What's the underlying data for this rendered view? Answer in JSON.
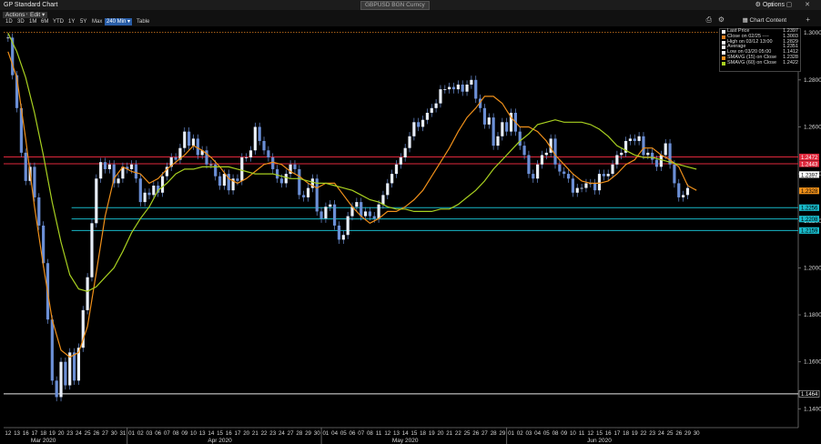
{
  "window": {
    "title": "GP Standard Chart",
    "ticker": "GBPUSD BGN Curncy",
    "options_label": "Options",
    "chart_content_label": "Chart Content",
    "controls": "▭ ▢ ✕"
  },
  "toolbar": {
    "menus": [
      "Actions ▾",
      "Edit ▾"
    ],
    "ranges": [
      "1D",
      "3D",
      "1M",
      "6M",
      "YTD",
      "1Y",
      "5Y",
      "Max",
      "240 Min ▾",
      "Table"
    ],
    "active_range": "240 Min ▾"
  },
  "colors": {
    "price": "#6b8fd6",
    "sma15": "#f0901a",
    "sma60": "#a8d020",
    "resistance": "#e0283c",
    "support": "#18b8c8",
    "low_line": "#e8e8e8",
    "high_dotted": "#e08020"
  },
  "legend": [
    {
      "label": "Last Price",
      "value": "1.2397",
      "color": "#ffffff"
    },
    {
      "label": "Close on 02/25 ----",
      "value": "1.3003",
      "color": "#e08020"
    },
    {
      "label": "High on 03/12 13:00",
      "value": "1.2829",
      "color": "#ffffff"
    },
    {
      "label": "Average",
      "value": "1.2351",
      "color": "#ffffff"
    },
    {
      "label": "Low on 03/20 05:00",
      "value": "1.1412",
      "color": "#ffffff"
    },
    {
      "label": "SMAVG (15)  on Close",
      "value": "1.2328",
      "color": "#f0901a"
    },
    {
      "label": "SMAVG (60)  on Close",
      "value": "1.2422",
      "color": "#a8d020"
    }
  ],
  "chart_data": {
    "type": "line",
    "title": "",
    "xlabel": "",
    "ylabel": "",
    "ylim": [
      1.132,
      1.302
    ],
    "y_ticks": [
      "1.3000",
      "1.2800",
      "1.2600",
      "1.2400",
      "1.2200",
      "1.2000",
      "1.1800",
      "1.1600",
      "1.1400"
    ],
    "x_days": [
      "12",
      "13",
      "16",
      "17",
      "18",
      "19",
      "20",
      "23",
      "24",
      "25",
      "26",
      "27",
      "30",
      "31",
      "01",
      "02",
      "03",
      "06",
      "07",
      "08",
      "09",
      "10",
      "13",
      "14",
      "15",
      "16",
      "17",
      "20",
      "21",
      "22",
      "23",
      "24",
      "27",
      "28",
      "29",
      "30",
      "01",
      "04",
      "05",
      "06",
      "07",
      "08",
      "11",
      "12",
      "13",
      "14",
      "15",
      "18",
      "19",
      "20",
      "21",
      "22",
      "25",
      "26",
      "27",
      "28",
      "29",
      "01",
      "02",
      "03",
      "04",
      "05",
      "08",
      "09",
      "10",
      "11",
      "12",
      "15",
      "16",
      "17",
      "18",
      "19",
      "22",
      "23",
      "24",
      "25",
      "26",
      "29",
      "30"
    ],
    "x_months": [
      {
        "label": "Mar 2020",
        "day_index": 4
      },
      {
        "label": "Apr 2020",
        "day_index": 24
      },
      {
        "label": "May 2020",
        "day_index": 45
      },
      {
        "label": "Jun 2020",
        "day_index": 67
      }
    ],
    "month_separators": [
      14,
      36,
      57
    ],
    "series": [
      {
        "name": "Last Price",
        "day_index": [
          0,
          0.5,
          1,
          1.5,
          2,
          2.5,
          3,
          3.5,
          4,
          4.5,
          5,
          5.5,
          6,
          6.5,
          7,
          7.5,
          8,
          8.5,
          9,
          9.5,
          10,
          10.5,
          11,
          11.5,
          12,
          12.5,
          13,
          13.5,
          14,
          14.5,
          15,
          15.5,
          16,
          16.5,
          17,
          17.5,
          18,
          18.5,
          19,
          19.5,
          20,
          20.5,
          21,
          21.5,
          22,
          22.5,
          23,
          23.5,
          24,
          24.5,
          25,
          25.5,
          26,
          26.5,
          27,
          27.5,
          28,
          28.5,
          29,
          29.5,
          30,
          30.5,
          31,
          31.5,
          32,
          32.5,
          33,
          33.5,
          34,
          34.5,
          35,
          35.5,
          36,
          36.5,
          37,
          37.5,
          38,
          38.5,
          39,
          39.5,
          40,
          40.5,
          41,
          41.5,
          42,
          42.5,
          43,
          43.5,
          44,
          44.5,
          45,
          45.5,
          46,
          46.5,
          47,
          47.5,
          48,
          48.5,
          49,
          49.5,
          50,
          50.5,
          51,
          51.5,
          52,
          52.5,
          53,
          53.5,
          54,
          54.5,
          55,
          55.5,
          56,
          56.5,
          57,
          57.5,
          58,
          58.5,
          59,
          59.5,
          60,
          60.5,
          61,
          61.5,
          62,
          62.5,
          63,
          63.5,
          64,
          64.5,
          65,
          65.5,
          66,
          66.5,
          67,
          67.5,
          68,
          68.5,
          69,
          69.5,
          70,
          70.5,
          71,
          71.5,
          72,
          72.5,
          73,
          73.5,
          74,
          74.5,
          75,
          75.5,
          76,
          76.5,
          77,
          77.5,
          78
        ],
        "values": [
          1.298,
          1.282,
          1.268,
          1.249,
          1.237,
          1.243,
          1.23,
          1.218,
          1.202,
          1.178,
          1.152,
          1.145,
          1.16,
          1.15,
          1.164,
          1.152,
          1.166,
          1.182,
          1.196,
          1.219,
          1.238,
          1.245,
          1.242,
          1.244,
          1.236,
          1.238,
          1.243,
          1.242,
          1.244,
          1.238,
          1.228,
          1.232,
          1.231,
          1.235,
          1.232,
          1.239,
          1.243,
          1.247,
          1.246,
          1.251,
          1.258,
          1.252,
          1.255,
          1.248,
          1.25,
          1.244,
          1.244,
          1.239,
          1.235,
          1.24,
          1.233,
          1.238,
          1.237,
          1.247,
          1.247,
          1.25,
          1.26,
          1.254,
          1.25,
          1.247,
          1.242,
          1.238,
          1.236,
          1.24,
          1.244,
          1.242,
          1.231,
          1.23,
          1.234,
          1.238,
          1.224,
          1.221,
          1.226,
          1.227,
          1.218,
          1.212,
          1.214,
          1.222,
          1.226,
          1.228,
          1.222,
          1.224,
          1.222,
          1.221,
          1.227,
          1.231,
          1.236,
          1.24,
          1.244,
          1.247,
          1.251,
          1.256,
          1.262,
          1.26,
          1.263,
          1.266,
          1.268,
          1.27,
          1.276,
          1.276,
          1.277,
          1.276,
          1.278,
          1.275,
          1.278,
          1.28,
          1.272,
          1.268,
          1.261,
          1.264,
          1.252,
          1.256,
          1.262,
          1.258,
          1.266,
          1.258,
          1.252,
          1.248,
          1.24,
          1.238,
          1.244,
          1.248,
          1.249,
          1.255,
          1.244,
          1.241,
          1.24,
          1.238,
          1.232,
          1.234,
          1.234,
          1.236,
          1.236,
          1.233,
          1.24,
          1.239,
          1.24,
          1.244,
          1.248,
          1.249,
          1.254,
          1.255,
          1.254,
          1.256,
          1.248,
          1.249,
          1.246,
          1.243,
          1.248,
          1.253,
          1.244,
          1.236,
          1.23,
          1.231,
          1.234
        ]
      },
      {
        "name": "SMAVG (15)  on Close",
        "day_index": [
          0,
          1,
          2,
          3,
          4,
          5,
          6,
          7,
          8,
          9,
          10,
          11,
          12,
          13,
          14,
          15,
          16,
          17,
          18,
          19,
          20,
          21,
          22,
          23,
          24,
          25,
          26,
          27,
          28,
          29,
          30,
          31,
          32,
          33,
          34,
          35,
          36,
          37,
          38,
          39,
          40,
          41,
          42,
          43,
          44,
          45,
          46,
          47,
          48,
          49,
          50,
          51,
          52,
          53,
          54,
          55,
          56,
          57,
          58,
          59,
          60,
          61,
          62,
          63,
          64,
          65,
          66,
          67,
          68,
          69,
          70,
          71,
          72,
          73,
          74,
          75,
          76,
          77,
          78
        ],
        "values": [
          1.292,
          1.281,
          1.255,
          1.226,
          1.201,
          1.178,
          1.165,
          1.162,
          1.164,
          1.175,
          1.198,
          1.222,
          1.238,
          1.243,
          1.241,
          1.24,
          1.236,
          1.238,
          1.242,
          1.245,
          1.248,
          1.252,
          1.25,
          1.247,
          1.243,
          1.238,
          1.236,
          1.238,
          1.241,
          1.244,
          1.245,
          1.244,
          1.241,
          1.239,
          1.236,
          1.234,
          1.236,
          1.236,
          1.231,
          1.226,
          1.222,
          1.219,
          1.221,
          1.224,
          1.224,
          1.226,
          1.229,
          1.233,
          1.239,
          1.245,
          1.251,
          1.258,
          1.264,
          1.268,
          1.273,
          1.273,
          1.27,
          1.264,
          1.26,
          1.26,
          1.258,
          1.254,
          1.248,
          1.244,
          1.24,
          1.237,
          1.236,
          1.236,
          1.237,
          1.24,
          1.244,
          1.246,
          1.251,
          1.251,
          1.248,
          1.246,
          1.243,
          1.235,
          1.233
        ]
      },
      {
        "name": "SMAVG (60)  on Close",
        "day_index": [
          0,
          1,
          2,
          3,
          4,
          5,
          6,
          7,
          8,
          9,
          10,
          11,
          12,
          13,
          14,
          15,
          16,
          17,
          18,
          19,
          20,
          21,
          22,
          23,
          24,
          25,
          26,
          27,
          28,
          29,
          30,
          31,
          32,
          33,
          34,
          35,
          36,
          37,
          38,
          39,
          40,
          41,
          42,
          43,
          44,
          45,
          46,
          47,
          48,
          49,
          50,
          51,
          52,
          53,
          54,
          55,
          56,
          57,
          58,
          59,
          60,
          61,
          62,
          63,
          64,
          65,
          66,
          67,
          68,
          69,
          70,
          71,
          72,
          73,
          74,
          75,
          76,
          77,
          78
        ],
        "values": [
          1.3,
          1.292,
          1.281,
          1.266,
          1.248,
          1.228,
          1.211,
          1.197,
          1.191,
          1.19,
          1.192,
          1.196,
          1.2,
          1.207,
          1.215,
          1.221,
          1.226,
          1.233,
          1.236,
          1.24,
          1.242,
          1.242,
          1.243,
          1.243,
          1.243,
          1.243,
          1.242,
          1.241,
          1.24,
          1.24,
          1.24,
          1.239,
          1.238,
          1.238,
          1.237,
          1.236,
          1.236,
          1.235,
          1.234,
          1.233,
          1.231,
          1.229,
          1.228,
          1.226,
          1.225,
          1.225,
          1.224,
          1.224,
          1.224,
          1.225,
          1.225,
          1.227,
          1.23,
          1.233,
          1.237,
          1.242,
          1.246,
          1.25,
          1.254,
          1.257,
          1.261,
          1.262,
          1.263,
          1.262,
          1.262,
          1.262,
          1.261,
          1.259,
          1.256,
          1.252,
          1.25,
          1.248,
          1.247,
          1.247,
          1.246,
          1.245,
          1.244,
          1.243,
          1.242
        ]
      }
    ],
    "horizontal_levels": [
      {
        "value": 1.2472,
        "label": "1.2472",
        "kind": "resistance",
        "start_day": 0
      },
      {
        "value": 1.2443,
        "label": "1.2443",
        "kind": "resistance",
        "start_day": 0
      },
      {
        "value": 1.2397,
        "label": "1.2397",
        "kind": "last_price",
        "start_day": 0
      },
      {
        "value": 1.2328,
        "label": "1.2328",
        "kind": "sma15",
        "start_day": null
      },
      {
        "value": 1.2256,
        "label": "1.2256",
        "kind": "support",
        "start_day": 14
      },
      {
        "value": 1.2208,
        "label": "1.2208",
        "kind": "support",
        "start_day": 14
      },
      {
        "value": 1.2159,
        "label": "1.2159",
        "kind": "support",
        "start_day": 14
      },
      {
        "value": 1.1464,
        "label": "1.1464",
        "kind": "low",
        "start_day": 0
      }
    ],
    "reference_line": {
      "value": 1.3003,
      "style": "dotted"
    },
    "grid": false,
    "legend_position": "top-right"
  }
}
